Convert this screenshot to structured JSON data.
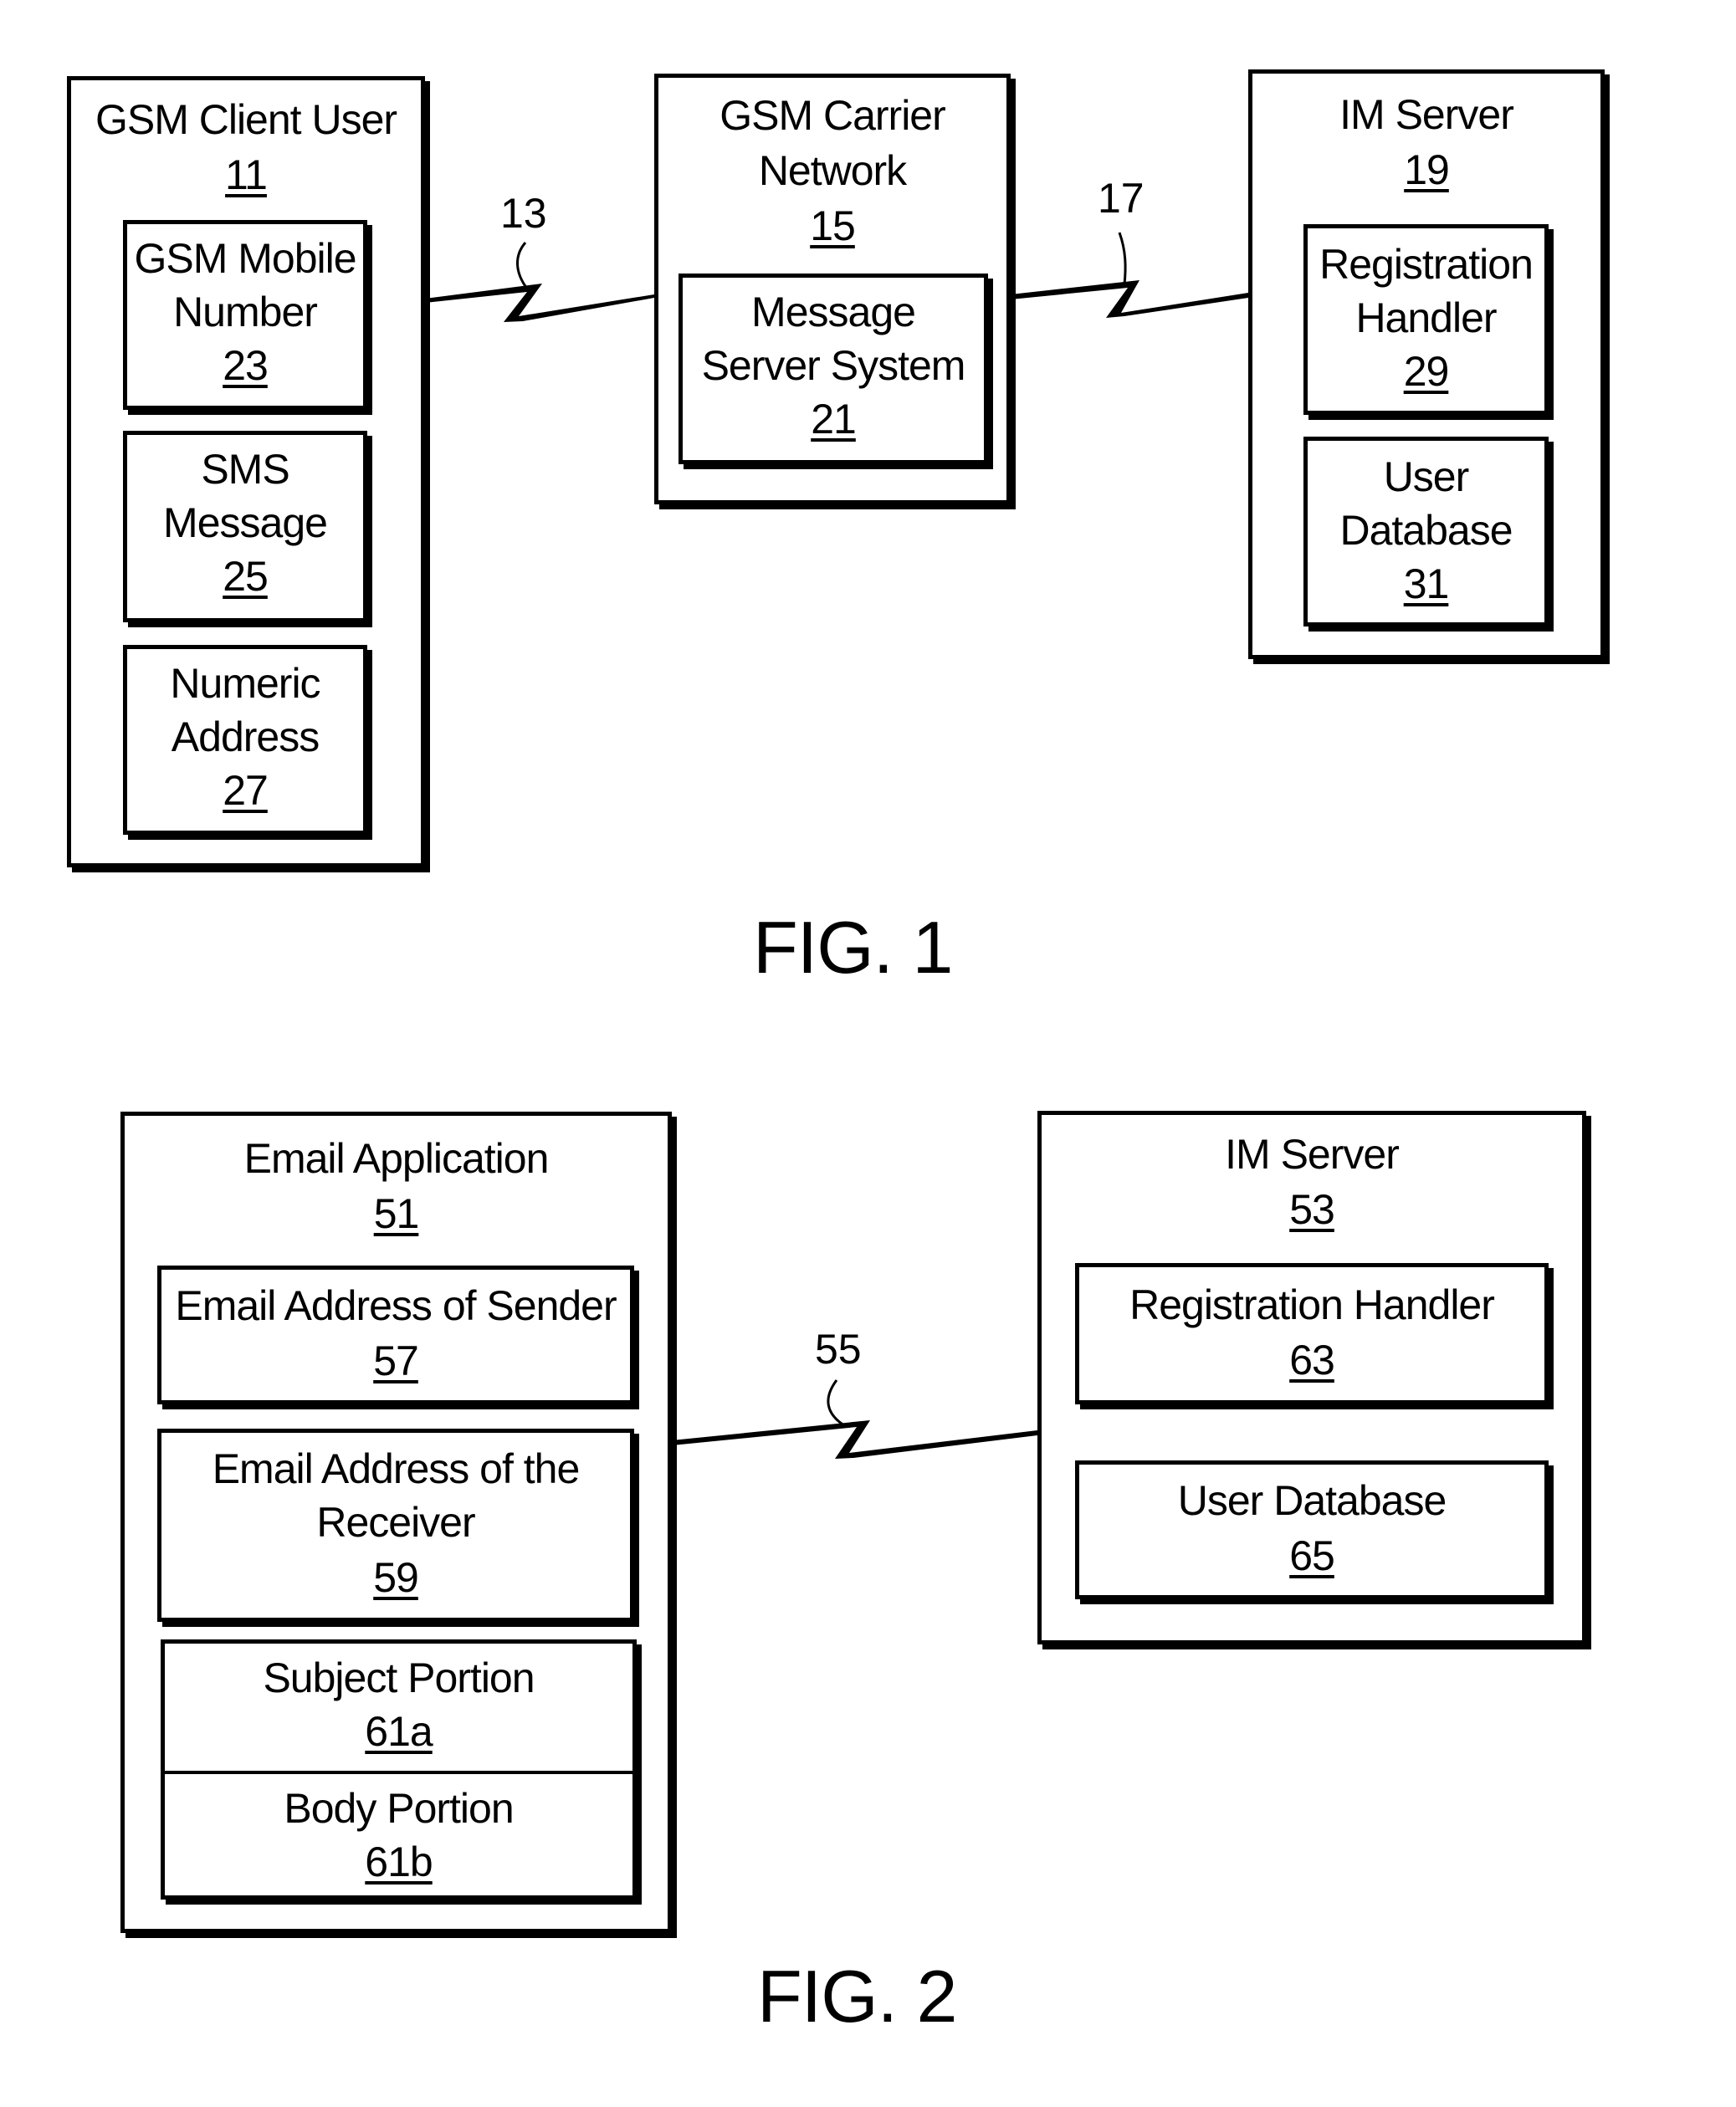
{
  "fig1": {
    "caption": "FIG. 1",
    "gsm_client": {
      "title": "GSM Client User",
      "num": "11",
      "items": [
        {
          "label1": "GSM Mobile",
          "label2": "Number",
          "num": "23"
        },
        {
          "label1": "SMS",
          "label2": "Message",
          "num": "25"
        },
        {
          "label1": "Numeric",
          "label2": "Address",
          "num": "27"
        }
      ]
    },
    "carrier": {
      "title1": "GSM Carrier",
      "title2": "Network",
      "num": "15",
      "item": {
        "label1": "Message",
        "label2": "Server System",
        "num": "21"
      }
    },
    "im_server": {
      "title": "IM Server",
      "num": "19",
      "items": [
        {
          "label1": "Registration",
          "label2": "Handler",
          "num": "29"
        },
        {
          "label1": "User",
          "label2": "Database",
          "num": "31"
        }
      ]
    },
    "link1": "13",
    "link2": "17"
  },
  "fig2": {
    "caption": "FIG. 2",
    "email_app": {
      "title": "Email Application",
      "num": "51",
      "items": [
        {
          "label1": "Email Address of Sender",
          "num": "57"
        },
        {
          "label1": "Email Address of the",
          "label2": "Receiver",
          "num": "59"
        },
        {
          "label1": "Subject Portion",
          "num": "61a"
        },
        {
          "label1": "Body Portion",
          "num": "61b"
        }
      ]
    },
    "im_server": {
      "title": "IM Server",
      "num": "53",
      "items": [
        {
          "label1": "Registration Handler",
          "num": "63"
        },
        {
          "label1": "User Database",
          "num": "65"
        }
      ]
    },
    "link": "55"
  }
}
